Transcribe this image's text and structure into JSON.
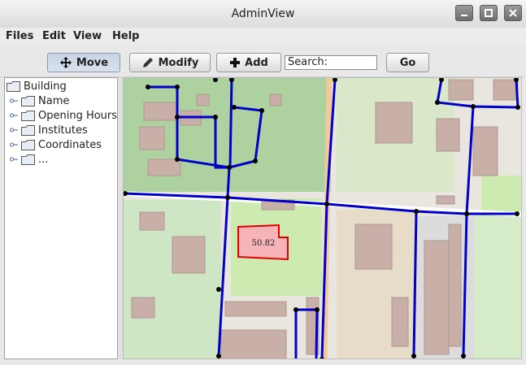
{
  "window": {
    "title": "AdminView"
  },
  "menubar": {
    "items": [
      "Files",
      "Edit",
      "View",
      "Help"
    ]
  },
  "toolbar": {
    "move_label": "Move",
    "modify_label": "Modify",
    "add_label": "Add",
    "search_placeholder": "Search:",
    "go_label": "Go"
  },
  "tree": {
    "root": "Building",
    "children": [
      "Name",
      "Opening Hours",
      "Institutes",
      "Coordinates",
      "..."
    ]
  },
  "map": {
    "selected_area_label": "50.82",
    "colors": {
      "path": "#0000c8",
      "node": "#000000",
      "selection_fill": "#f6b4b8",
      "selection_stroke": "#e00000"
    }
  }
}
